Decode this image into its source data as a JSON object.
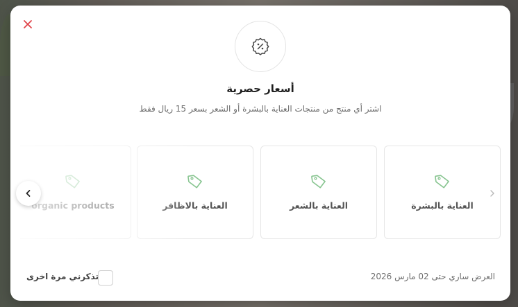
{
  "modal": {
    "title": "أسعار حصرية",
    "subtitle": "اشتر أي منتج من منتجات العناية بالبشرة أو الشعر بسعر 15 ريال فقط"
  },
  "categories": [
    {
      "label": "العناية بالبشرة"
    },
    {
      "label": "العناية بالشعر"
    },
    {
      "label": "العناية بالاظافر"
    },
    {
      "label": "organic products"
    }
  ],
  "footer": {
    "dont_remind_label": "لا تذكرني مرة اخرى",
    "offer_validity": "العرض ساري حتى 02 مارس 2026"
  },
  "colors": {
    "accent": "#86c48f",
    "close": "#e0444a"
  },
  "icons": {
    "close": "close-icon",
    "badge": "discount-badge-icon",
    "tag": "tag-icon",
    "prev": "chevron-left-icon",
    "next": "chevron-right-icon"
  }
}
